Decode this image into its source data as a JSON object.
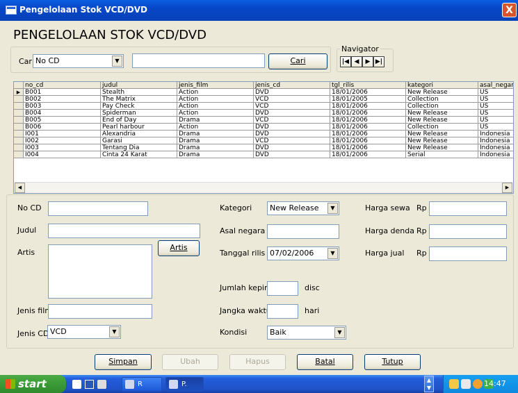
{
  "window": {
    "title": "Pengelolaan Stok VCD/DVD",
    "close_label": "X"
  },
  "heading": "PENGELOLAAN STOK VCD/DVD",
  "search": {
    "label": "Cari",
    "field_selected": "No CD",
    "query_value": "",
    "button_label": "Cari"
  },
  "navigator": {
    "label": "Navigator",
    "buttons": [
      "first",
      "prev",
      "next",
      "last"
    ]
  },
  "grid": {
    "columns": [
      "no_cd",
      "judul",
      "jenis_film",
      "jenis_cd",
      "tgl_rilis",
      "kategori",
      "asal_negara"
    ],
    "rows": [
      [
        "B001",
        "Stealth",
        "Action",
        "DVD",
        "18/01/2006",
        "New Release",
        "US"
      ],
      [
        "B002",
        "The Matrix",
        "Action",
        "VCD",
        "18/01/2005",
        "Collection",
        "US"
      ],
      [
        "B003",
        "Pay Check",
        "Action",
        "VCD",
        "18/01/2006",
        "Collection",
        "US"
      ],
      [
        "B004",
        "Spiderman",
        "Action",
        "DVD",
        "18/01/2006",
        "New Release",
        "US"
      ],
      [
        "B005",
        "End of Day",
        "Drama",
        "VCD",
        "18/01/2006",
        "New Release",
        "US"
      ],
      [
        "B006",
        "Pearl harbour",
        "Action",
        "DVD",
        "18/01/2006",
        "Collection",
        "US"
      ],
      [
        "I001",
        "Alexandria",
        "Drama",
        "DVD",
        "18/01/2006",
        "New Release",
        "Indonesia"
      ],
      [
        "I002",
        "Garasi",
        "Drama",
        "VCD",
        "18/01/2006",
        "New Release",
        "Indonesia"
      ],
      [
        "I003",
        "Tentang Dia",
        "Drama",
        "DVD",
        "18/01/2006",
        "New Release",
        "Indonesia"
      ],
      [
        "I004",
        "Cinta 24 Karat",
        "Drama",
        "DVD",
        "18/01/2006",
        "Serial",
        "Indonesia"
      ]
    ],
    "selected_row": 0
  },
  "form": {
    "no_cd_label": "No CD",
    "no_cd_value": "",
    "judul_label": "Judul",
    "judul_value": "",
    "artis_label": "Artis",
    "artis_value": "",
    "artis_button": "Artis",
    "jenis_film_label": "Jenis film",
    "jenis_film_value": "",
    "jenis_cd_label": "Jenis CD",
    "jenis_cd_value": "VCD",
    "kategori_label": "Kategori",
    "kategori_value": "New Release",
    "asal_negara_label": "Asal negara",
    "asal_negara_value": "",
    "tanggal_rilis_label": "Tanggal rilis",
    "tanggal_rilis_value": "07/02/2006",
    "jumlah_keping_label": "Jumlah keping",
    "jumlah_keping_value": "",
    "jumlah_keping_unit": "disc",
    "jangka_waktu_label": "Jangka waktu",
    "jangka_waktu_value": "",
    "jangka_waktu_unit": "hari",
    "kondisi_label": "Kondisi",
    "kondisi_value": "Baik",
    "harga_sewa_label": "Harga sewa",
    "harga_denda_label": "Harga denda",
    "harga_jual_label": "Harga jual",
    "currency": "Rp",
    "harga_sewa_value": "",
    "harga_denda_value": "",
    "harga_jual_value": ""
  },
  "actions": {
    "simpan": "Simpan",
    "ubah": "Ubah",
    "hapus": "Hapus",
    "batal": "Batal",
    "tutup": "Tutup"
  },
  "taskbar": {
    "start_label": "start",
    "tasks": [
      "R",
      "P."
    ],
    "clock": "14:47"
  }
}
